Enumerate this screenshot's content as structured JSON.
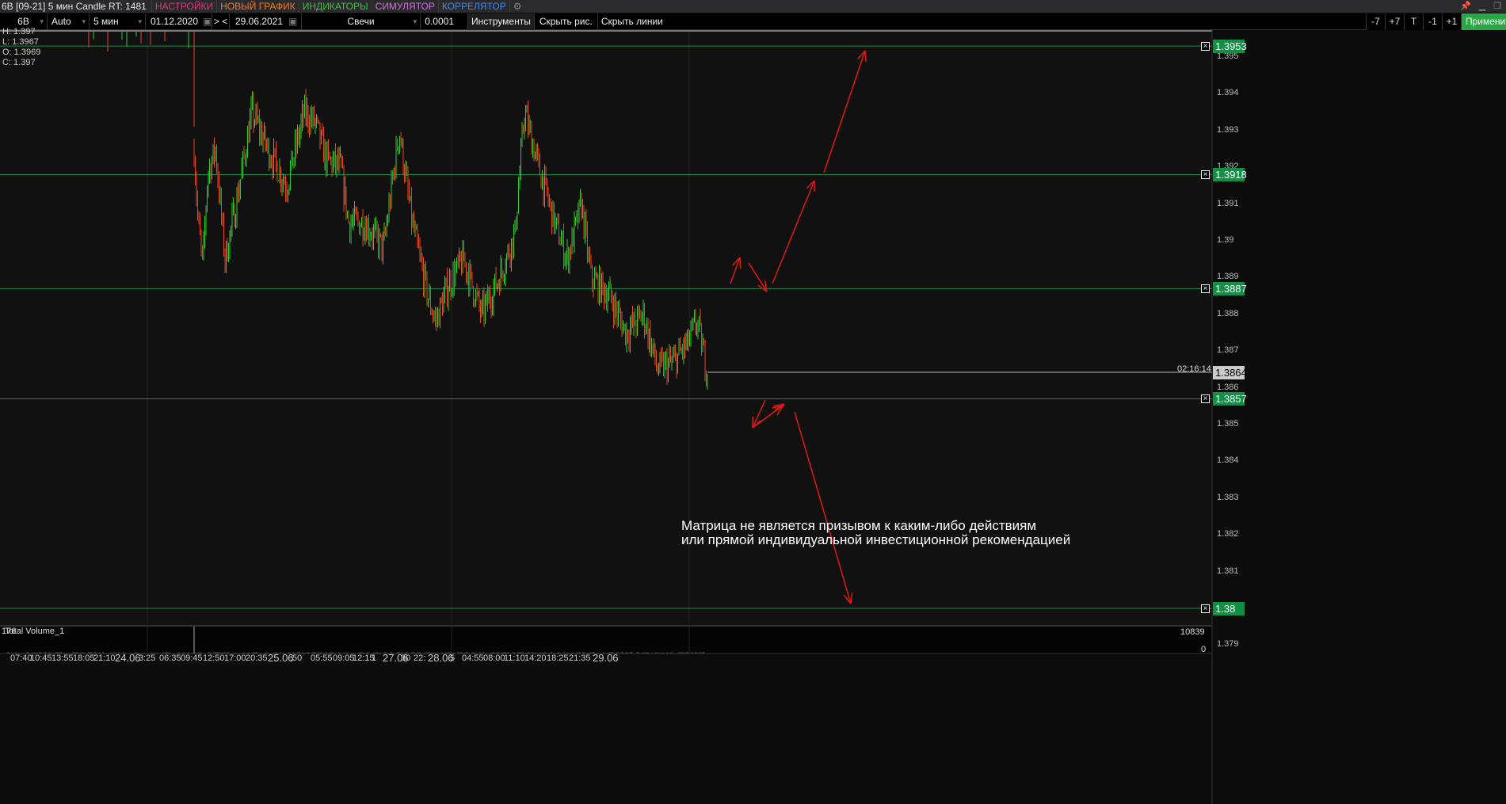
{
  "title": "6B [09-21] 5 мин Candle RT: 1481",
  "menu": [
    {
      "label": "НАСТРОЙКИ",
      "color": "#e8307a"
    },
    {
      "label": "НОВЫЙ ГРАФИК",
      "color": "#f07a1a"
    },
    {
      "label": "ИНДИКАТОРЫ",
      "color": "#3cc43c"
    },
    {
      "label": "СИМУЛЯТОР",
      "color": "#d070e0"
    },
    {
      "label": "КОРРЕЛЯТОР",
      "color": "#3a8ef0"
    }
  ],
  "toolbar": {
    "symbol": "6B",
    "scale": "Auto",
    "timeframe": "5 мин",
    "date_from": "01.12.2020",
    "nav": "> <",
    "date_to": "29.06.2021",
    "chart_type": "Свечи",
    "step": "0.0001",
    "tools": "Инструменты",
    "hide_drawings": "Скрыть рис.",
    "hide_lines": "Скрыть линии"
  },
  "right_buttons": [
    "-7",
    "+7",
    "T",
    "-1",
    "+1"
  ],
  "apply": "Применить",
  "ohlc": {
    "h": "H: 1.397",
    "l": "L: 1.3967",
    "o": "O: 1.3969",
    "c": "C: 1.397"
  },
  "price_ticks": [
    "1.395",
    "1.394",
    "1.393",
    "1.392",
    "1.391",
    "1.39",
    "1.389",
    "1.388",
    "1.387",
    "1.386",
    "1.385",
    "1.384",
    "1.383",
    "1.382",
    "1.381",
    "1.379"
  ],
  "levels": [
    "1.3953",
    "1.3918",
    "1.3887",
    "1.3857",
    "1.38"
  ],
  "current": {
    "price": "1.3864",
    "timer": "02:16:14"
  },
  "note": [
    "Матрица не является призывом к каким-либо действиям",
    "или прямой индивидуальной инвестиционной рекомендацией"
  ],
  "volume": {
    "label": "Total Volume_1",
    "prefix": "176",
    "max": "10839",
    "min": "0"
  },
  "time_labels": [
    "07:40",
    "10:45",
    "13:55",
    "18:05",
    "21:10",
    "24.06",
    "3:25",
    "06:35",
    "09:45",
    "12:50",
    "17:00",
    "20:35",
    "25.06",
    ":50",
    "05:55",
    "09:05",
    "12:15",
    "1",
    "27.06",
    "30",
    "22:",
    "28.06",
    "5",
    "04:55",
    "08:00",
    "11:10",
    "14:20",
    "18:25",
    "21:35",
    "29.06"
  ],
  "price_path": [
    [
      245,
      1.3925
    ],
    [
      250,
      1.3905
    ],
    [
      256,
      1.3893
    ],
    [
      262,
      1.3918
    ],
    [
      272,
      1.3925
    ],
    [
      284,
      1.3895
    ],
    [
      298,
      1.391
    ],
    [
      318,
      1.3935
    ],
    [
      338,
      1.3925
    ],
    [
      362,
      1.3915
    ],
    [
      384,
      1.3935
    ],
    [
      398,
      1.3932
    ],
    [
      412,
      1.3922
    ],
    [
      430,
      1.392
    ],
    [
      440,
      1.3905
    ],
    [
      460,
      1.3905
    ],
    [
      484,
      1.3898
    ],
    [
      504,
      1.393
    ],
    [
      520,
      1.3905
    ],
    [
      540,
      1.3885
    ],
    [
      550,
      1.3878
    ],
    [
      566,
      1.3888
    ],
    [
      585,
      1.3895
    ],
    [
      608,
      1.388
    ],
    [
      630,
      1.389
    ],
    [
      650,
      1.3902
    ],
    [
      662,
      1.3935
    ],
    [
      680,
      1.392
    ],
    [
      700,
      1.3905
    ],
    [
      716,
      1.3895
    ],
    [
      734,
      1.391
    ],
    [
      746,
      1.389
    ],
    [
      770,
      1.3885
    ],
    [
      790,
      1.3875
    ],
    [
      812,
      1.388
    ],
    [
      830,
      1.3865
    ],
    [
      850,
      1.3867
    ],
    [
      868,
      1.3872
    ],
    [
      880,
      1.3878
    ],
    [
      893,
      1.3864
    ]
  ],
  "colors": {
    "up": "#2ecc2e",
    "down": "#e8461e",
    "level": "#1e8a4a",
    "arrow": "#e01818"
  }
}
